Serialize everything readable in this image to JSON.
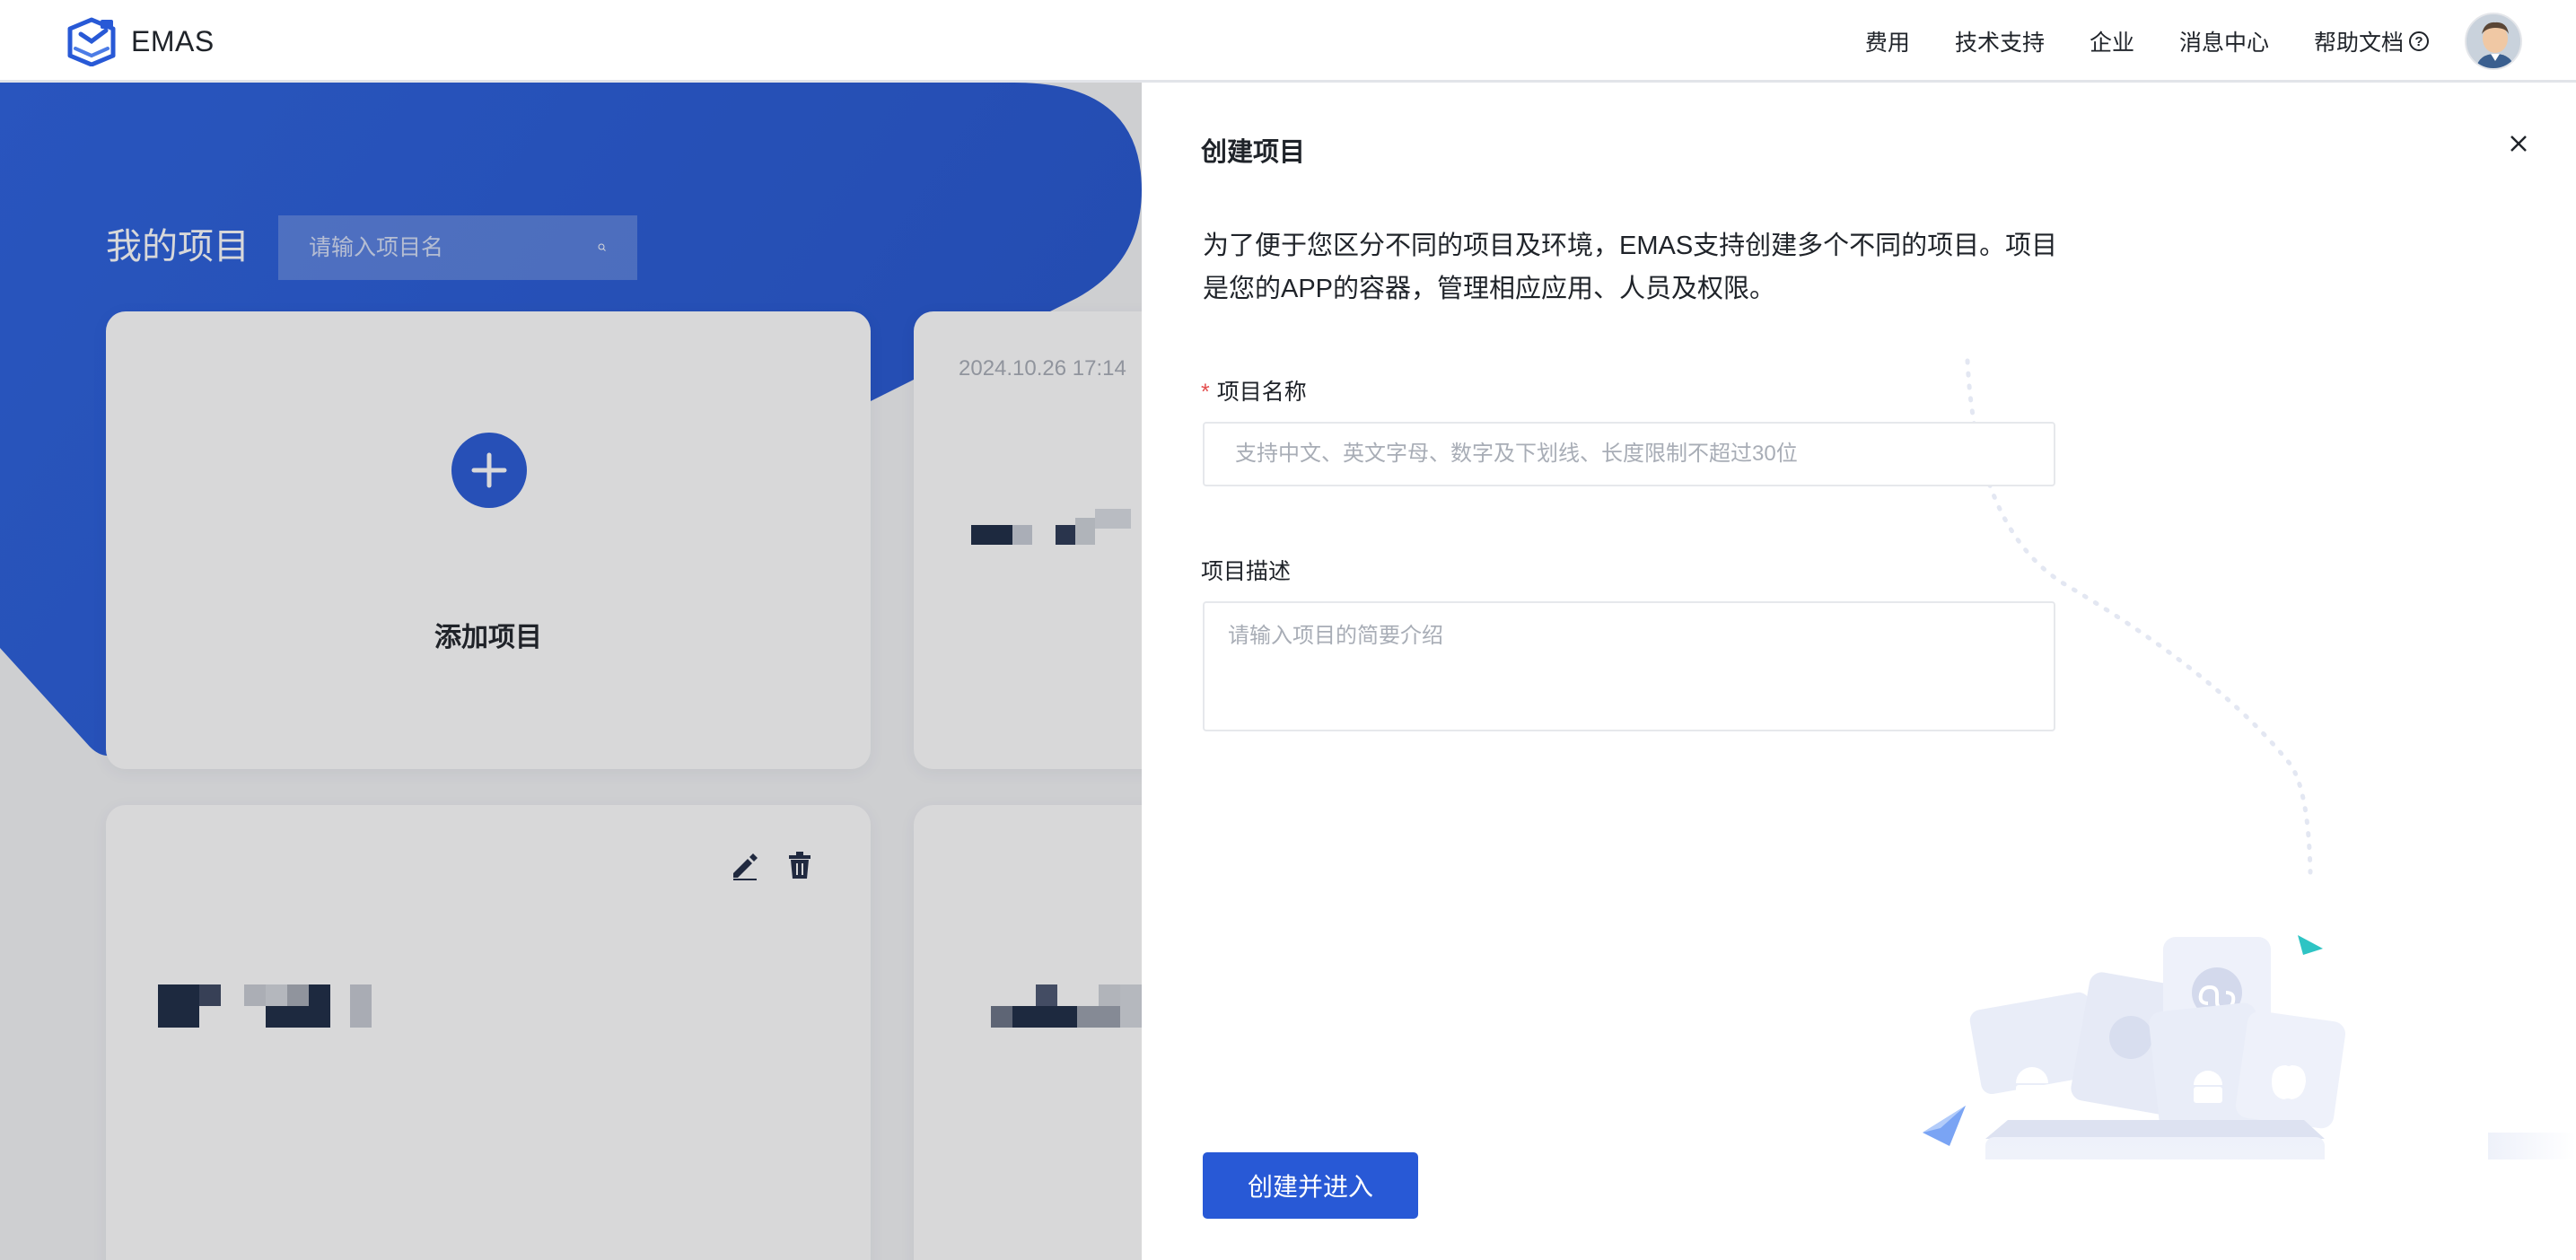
{
  "topbar": {
    "brand": "EMAS",
    "nav": [
      {
        "label": "费用"
      },
      {
        "label": "技术支持"
      },
      {
        "label": "企业"
      },
      {
        "label": "消息中心"
      },
      {
        "label": "帮助文档"
      }
    ],
    "help_icon_glyph": "?"
  },
  "background": {
    "title": "我的项目",
    "search": {
      "placeholder": "请输入项目名"
    },
    "add_card": {
      "label": "添加项目"
    },
    "project_card": {
      "date": "2024.10.26 17:14"
    }
  },
  "drawer": {
    "title": "创建项目",
    "description": "为了便于您区分不同的项目及环境，EMAS支持创建多个不同的项目。项目是您的APP的容器，管理相应应用、人员及权限。",
    "name_field": {
      "required_mark": "*",
      "label": "项目名称",
      "placeholder": "支持中文、英文字母、数字及下划线、长度限制不超过30位",
      "value": ""
    },
    "desc_field": {
      "label": "项目描述",
      "placeholder": "请输入项目的简要介绍",
      "value": ""
    },
    "submit_label": "创建并进入"
  },
  "colors": {
    "brand_blue": "#2859d6",
    "required_red": "#e34d4d",
    "text_primary": "#1f2329",
    "placeholder_gray": "#a8adb6"
  },
  "icons": [
    "emas-logo-icon",
    "help-circle-icon",
    "avatar",
    "search-icon",
    "plus-icon",
    "edit-icon",
    "delete-icon",
    "close-icon"
  ]
}
